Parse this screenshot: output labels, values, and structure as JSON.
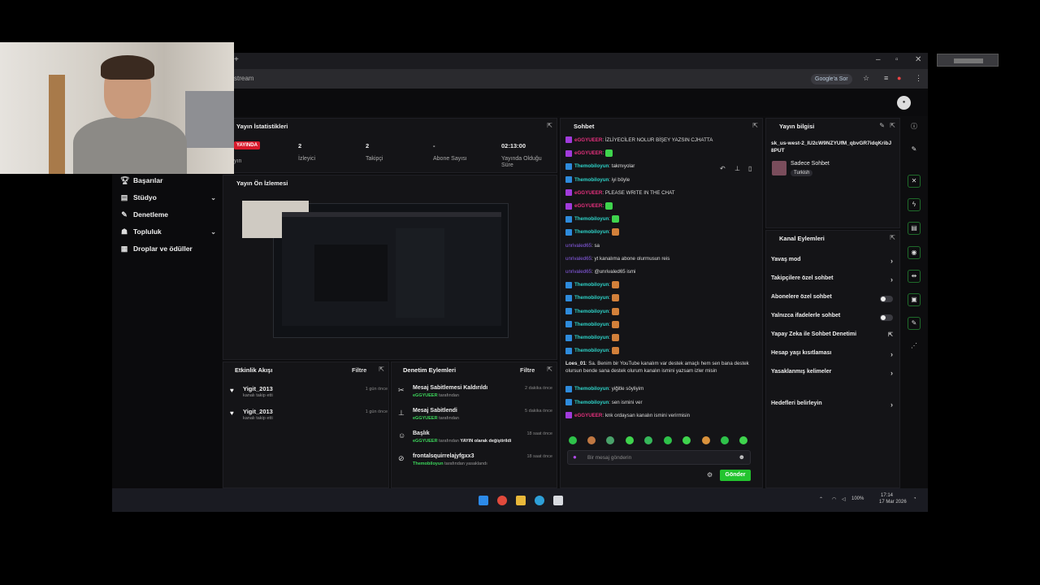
{
  "browser": {
    "url_fragment": "stream",
    "google_pill": "Google'a Sor"
  },
  "sidebar": {
    "items": [
      {
        "label": "Başarılar",
        "icon": "trophy-icon"
      },
      {
        "label": "Stüdyo",
        "icon": "studio-icon",
        "has_chevron": true
      },
      {
        "label": "Denetleme",
        "icon": "wrench-icon"
      },
      {
        "label": "Topluluk",
        "icon": "community-icon",
        "has_chevron": true
      },
      {
        "label": "Droplar ve ödüller",
        "icon": "gift-icon"
      }
    ]
  },
  "stats": {
    "title": "Yayın İstatistikleri",
    "live_badge": "YAYINDA",
    "live_sub": "yın",
    "viewers": {
      "value": "2",
      "label": "İzleyici"
    },
    "followers": {
      "value": "2",
      "label": "Takipçi"
    },
    "subscribers": {
      "value": "-",
      "label": "Abone Sayısı"
    },
    "duration": {
      "value": "02:13:00",
      "label": "Yayında Olduğu Süre"
    }
  },
  "preview": {
    "title": "Yayın Ön İzlemesi"
  },
  "activity": {
    "title": "Etkinlik Akışı",
    "filter": "Filtre",
    "items": [
      {
        "user": "Yigit_2013",
        "sub": "kanalı takip etti",
        "when": "1 gün önce"
      },
      {
        "user": "Yigit_2013",
        "sub": "kanalı takip etti",
        "when": "1 gün önce"
      }
    ]
  },
  "moderation": {
    "title": "Denetim Eylemleri",
    "filter": "Filtre",
    "items": [
      {
        "title": "Mesaj Sabitlemesi Kaldırıldı",
        "actor": "eGGYUEER",
        "sub": "tarafından",
        "extra": "",
        "when": "2 dakika önce",
        "icon": "unpin-icon"
      },
      {
        "title": "Mesaj Sabitlendi",
        "actor": "eGGYUEER",
        "sub": "tarafından",
        "extra": "",
        "when": "5 dakika önce",
        "icon": "pin-icon"
      },
      {
        "title": "Başlık",
        "actor": "eGGYUEER",
        "sub": "tarafından",
        "extra": "YAYIN olarak değiştirildi",
        "when": "18 saat önce",
        "icon": "users-icon"
      },
      {
        "title": "frontalsquirrelajyfgxx3",
        "actor": "Themobiloyun",
        "sub": "tarafından yasaklandı",
        "extra": "",
        "when": "18 saat önce",
        "icon": "ban-icon"
      }
    ]
  },
  "chat": {
    "title": "Sohbet",
    "messages": [
      {
        "badge": "mic",
        "user": "eGGYUEER",
        "ucolor": "pink",
        "text": ": İZLİYECİLER NOLUR BİŞEY YAZSIN CJHATTA",
        "emote": ""
      },
      {
        "badge": "mic",
        "user": "eGGYUEER",
        "ucolor": "pink",
        "text": ":",
        "emote": "green"
      },
      {
        "badge": "mod",
        "user": "Themobiloyun",
        "ucolor": "teal",
        "text": ": takmıyolar",
        "emote": ""
      },
      {
        "badge": "mod",
        "user": "Themobiloyun",
        "ucolor": "teal",
        "text": ": iyi böyle",
        "emote": ""
      },
      {
        "badge": "mic",
        "user": "eGGYUEER",
        "ucolor": "pink",
        "text": ": PLEASE WRITE IN THE CHAT",
        "emote": ""
      },
      {
        "badge": "mic",
        "user": "eGGYUEER",
        "ucolor": "pink",
        "text": ":",
        "emote": "green"
      },
      {
        "badge": "mod",
        "user": "Themobiloyun",
        "ucolor": "teal",
        "text": ":",
        "emote": "green"
      },
      {
        "badge": "mod",
        "user": "Themobiloyun",
        "ucolor": "teal",
        "text": ":",
        "emote": "orange"
      },
      {
        "badge": "",
        "user": "unrivaled65",
        "ucolor": "purple",
        "text": ": sa",
        "emote": ""
      },
      {
        "badge": "",
        "user": "unrivaled65",
        "ucolor": "purple",
        "text": ": yt kanalıma abone olurmusun reis",
        "emote": ""
      },
      {
        "badge": "",
        "user": "unrivaled65",
        "ucolor": "purple",
        "text": ": @unrivaled65 ismi",
        "emote": ""
      },
      {
        "badge": "mod",
        "user": "Themobiloyun",
        "ucolor": "teal",
        "text": ":",
        "emote": "orange"
      },
      {
        "badge": "mod",
        "user": "Themobiloyun",
        "ucolor": "teal",
        "text": ":",
        "emote": "orange"
      },
      {
        "badge": "mod",
        "user": "Themobiloyun",
        "ucolor": "teal",
        "text": ":",
        "emote": "orange"
      },
      {
        "badge": "mod",
        "user": "Themobiloyun",
        "ucolor": "teal",
        "text": ":",
        "emote": "orange"
      },
      {
        "badge": "mod",
        "user": "Themobiloyun",
        "ucolor": "teal",
        "text": ":",
        "emote": "orange"
      },
      {
        "badge": "mod",
        "user": "Themobiloyun",
        "ucolor": "teal",
        "text": ":",
        "emote": "orange"
      },
      {
        "badge": "",
        "user": "Loes_01",
        "ucolor": "white",
        "text": ": Sa. Benim bir YouTube kanalım var destek amaçlı hem sen bana destek olursun bende sana destek olurum kanalın ismini yazsam izler misin",
        "emote": ""
      },
      {
        "badge": "mod",
        "user": "Themobiloyun",
        "ucolor": "teal",
        "text": ": yiğitle söyliyim",
        "emote": ""
      },
      {
        "badge": "mod",
        "user": "Themobiloyun",
        "ucolor": "teal",
        "text": ": sen ismini ver",
        "emote": ""
      },
      {
        "badge": "mic",
        "user": "eGGYUEER",
        "ucolor": "pink",
        "text": ": knk ordaysan kanalın ismini verirmisin",
        "emote": ""
      }
    ],
    "input_placeholder": "Bir mesaj gönderin",
    "send_label": "Gönder"
  },
  "stream_info": {
    "title": "Yayın bilgisi",
    "key": "sk_us-west-2_IU2cW9NZYUfM_qbvGR7idqKribJ8PUT",
    "category": "Sadece Sohbet",
    "tag": "Turkish"
  },
  "channel_actions": {
    "title": "Kanal Eylemleri",
    "items": [
      {
        "label": "Yavaş mod",
        "control": "chevron"
      },
      {
        "label": "Takipçilere özel sohbet",
        "control": "chevron"
      },
      {
        "label": "Abonelere özel sohbet",
        "control": "toggle"
      },
      {
        "label": "Yalnızca ifadelerle sohbet",
        "control": "toggle"
      },
      {
        "label": "Yapay Zeka ile Sohbet Denetimi",
        "control": "external"
      },
      {
        "label": "Hesap yaşı kısıtlaması",
        "control": "chevron"
      },
      {
        "label": "Yasaklanmış kelimeler",
        "control": "chevron"
      },
      {
        "label": "Hedefleri belirleyin",
        "control": "chevron"
      }
    ]
  },
  "taskbar": {
    "clock": "17:14",
    "date": "17 Mar 2026",
    "battery": "100%"
  },
  "colors": {
    "accent_green": "#23c42f",
    "live_red": "#d8192b",
    "pink_user": "#e3307c",
    "teal_user": "#2ed3c8"
  }
}
